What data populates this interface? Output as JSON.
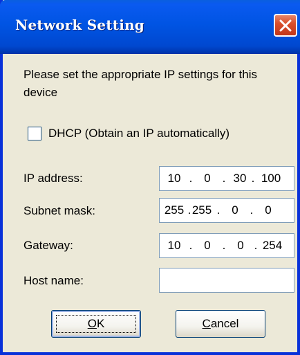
{
  "window": {
    "title": "Network Setting",
    "close_icon": "close-icon"
  },
  "message": "Please set the appropriate IP settings for this device",
  "dhcp": {
    "label": "DHCP (Obtain an IP automatically)",
    "checked": false
  },
  "fields": {
    "ip_address": {
      "label": "IP address:",
      "octets": [
        "10",
        "0",
        "30",
        "100"
      ]
    },
    "subnet_mask": {
      "label": "Subnet mask:",
      "octets": [
        "255",
        "255",
        "0",
        "0"
      ]
    },
    "gateway": {
      "label": "Gateway:",
      "octets": [
        "10",
        "0",
        "0",
        "254"
      ]
    },
    "host_name": {
      "label": "Host name:",
      "value": ""
    }
  },
  "buttons": {
    "ok": {
      "mnemonic": "O",
      "rest": "K"
    },
    "cancel": {
      "mnemonic": "C",
      "rest": "ancel"
    }
  },
  "colors": {
    "titlebar": "#0054e3",
    "dialog_bg": "#ece9d8",
    "close_button": "#d9502c"
  }
}
